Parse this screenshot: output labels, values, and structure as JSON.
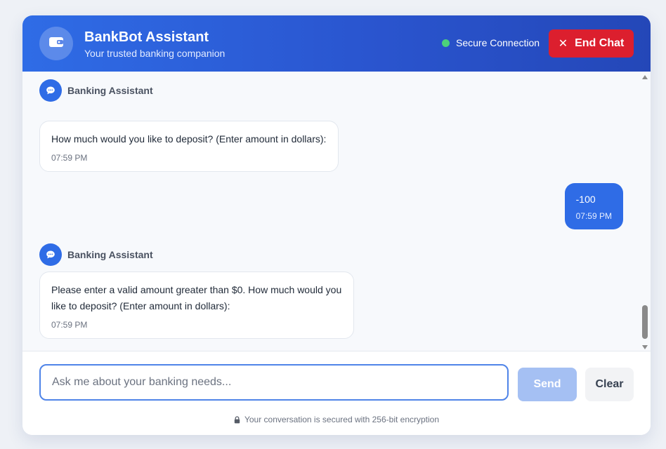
{
  "header": {
    "title": "BankBot Assistant",
    "subtitle": "Your trusted banking companion",
    "status_text": "Secure Connection",
    "end_chat_label": "End Chat",
    "icons": {
      "avatar": "wallet-icon",
      "end_chat": "close-icon"
    }
  },
  "messages": [
    {
      "from": "bot",
      "sender": "Banking Assistant",
      "text": "How much would you like to deposit? (Enter amount in dollars):",
      "time": "07:59 PM"
    },
    {
      "from": "user",
      "text": "-100",
      "time": "07:59 PM"
    },
    {
      "from": "bot",
      "sender": "Banking Assistant",
      "text": "Please enter a valid amount greater than $0. How much would you like to deposit? (Enter amount in dollars):",
      "time": "07:59 PM"
    }
  ],
  "input": {
    "value": "",
    "placeholder": "Ask me about your banking needs...",
    "send_label": "Send",
    "clear_label": "Clear"
  },
  "footer": {
    "security_note": "Your conversation is secured with 256-bit encryption"
  },
  "colors": {
    "primary": "#2f6ce6",
    "danger": "#dc1f2e",
    "status_online": "#4cd17a",
    "send_disabled": "#a5c0f3"
  }
}
